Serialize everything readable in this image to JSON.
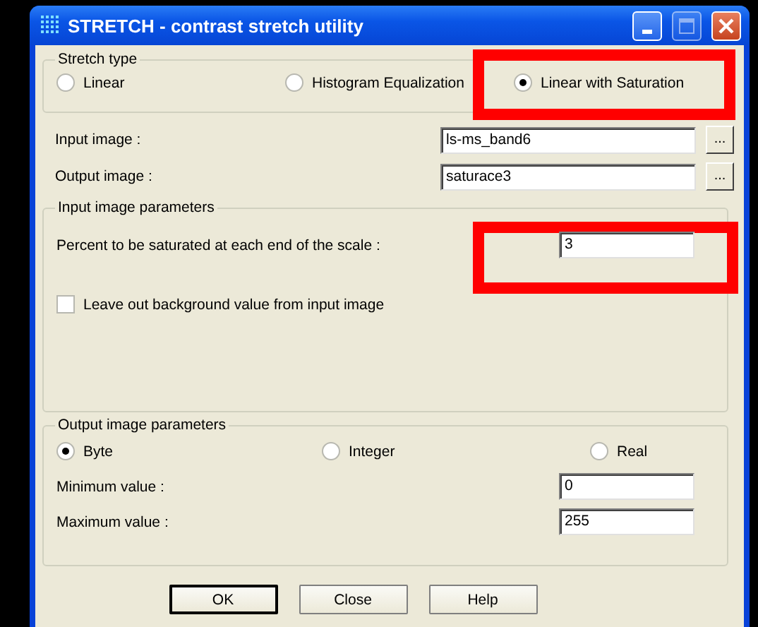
{
  "window": {
    "title": "STRETCH - contrast stretch utility"
  },
  "stretch_type": {
    "title": "Stretch type",
    "options": [
      {
        "label": "Linear",
        "selected": false
      },
      {
        "label": "Histogram Equalization",
        "selected": false
      },
      {
        "label": "Linear with Saturation",
        "selected": true
      }
    ]
  },
  "files": [
    {
      "label": "Input image :",
      "value": "ls-ms_band6",
      "button": "..."
    },
    {
      "label": "Output image :",
      "value": "saturace3",
      "button": "..."
    }
  ],
  "input_parameters": {
    "title": "Input image parameters",
    "percent": {
      "label": "Percent to be saturated at each end of the scale :",
      "value": "3"
    },
    "leave_out_background": {
      "label": "Leave out background value from input image",
      "checked": false
    }
  },
  "output_parameters": {
    "title": "Output image parameters",
    "types": [
      {
        "label": "Byte",
        "selected": true
      },
      {
        "label": "Integer",
        "selected": false
      },
      {
        "label": "Real",
        "selected": false
      }
    ],
    "fields": [
      {
        "label": "Minimum value :",
        "value": "0"
      },
      {
        "label": "Maximum value :",
        "value": "255"
      }
    ]
  },
  "buttons": [
    {
      "label": "OK",
      "default": true
    },
    {
      "label": "Close",
      "default": false
    },
    {
      "label": "Help",
      "default": false
    }
  ]
}
